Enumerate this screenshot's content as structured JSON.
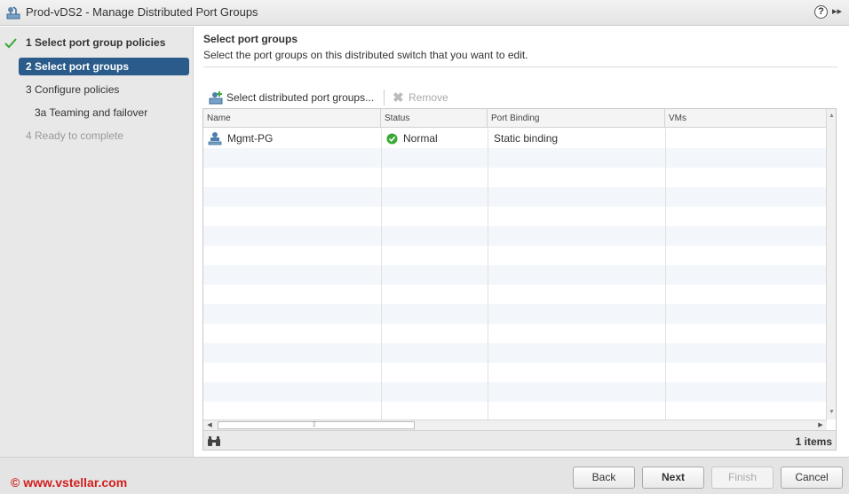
{
  "window": {
    "title": "Prod-vDS2 - Manage Distributed Port Groups",
    "help_label": "?",
    "expand_label": "▸▸"
  },
  "steps": [
    {
      "label": "1  Select port group policies",
      "state": "done"
    },
    {
      "label": "2  Select port groups",
      "state": "active"
    },
    {
      "label": "3  Configure policies",
      "state": "normal"
    },
    {
      "label": "3a  Teaming and failover",
      "state": "normal"
    },
    {
      "label": "4  Ready to complete",
      "state": "disabled"
    }
  ],
  "page": {
    "title": "Select port groups",
    "description": "Select the port groups on this distributed switch that you want to edit."
  },
  "toolbar": {
    "select_label": "Select distributed port groups...",
    "remove_label": "Remove"
  },
  "table": {
    "columns": [
      "Name",
      "Status",
      "Port Binding",
      "VMs"
    ],
    "rows": [
      {
        "name": "Mgmt-PG",
        "status": "Normal",
        "binding": "Static binding",
        "vms": ""
      }
    ],
    "item_count": "1 items"
  },
  "buttons": {
    "back": "Back",
    "next": "Next",
    "finish": "Finish",
    "cancel": "Cancel"
  },
  "watermark": "© www.vstellar.com",
  "colors": {
    "active_step": "#2a5b8a",
    "status_ok": "#3aa935",
    "watermark": "#d21f1f"
  }
}
